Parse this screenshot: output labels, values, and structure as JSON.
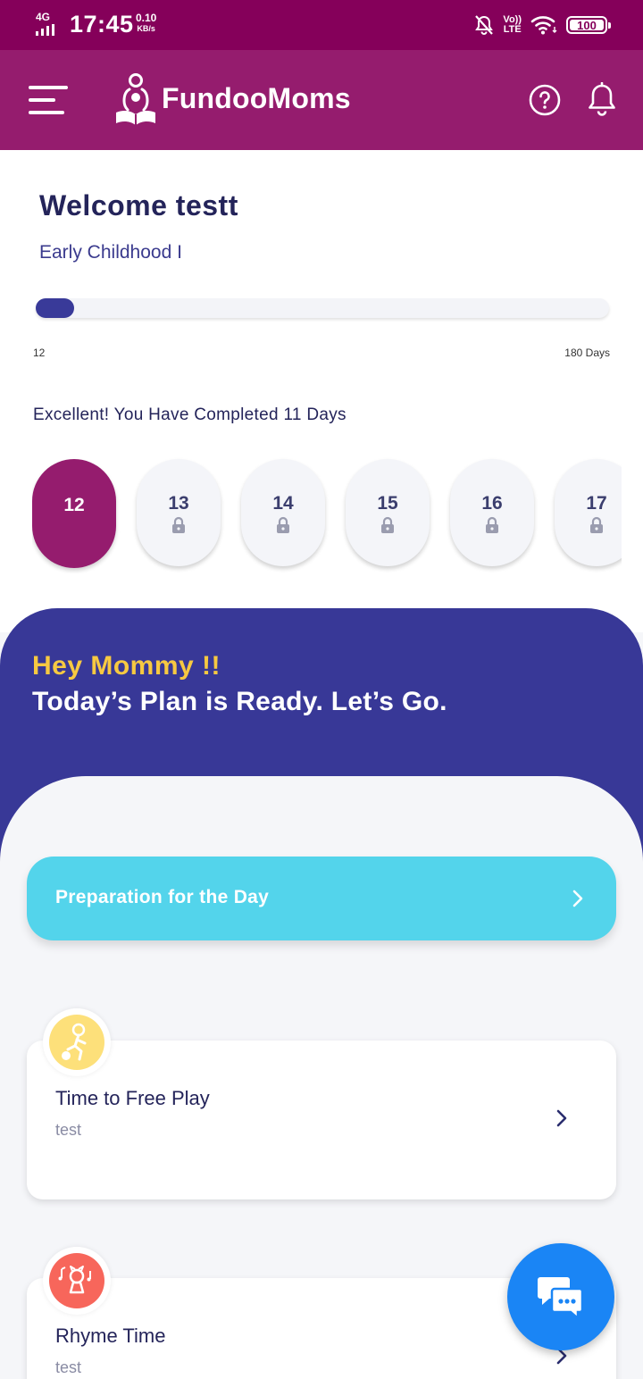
{
  "status_bar": {
    "network": "4G",
    "time": "17:45",
    "speed_value": "0.10",
    "speed_unit": "KB/s",
    "volte": "Vo))",
    "lte": "LTE",
    "battery": "100"
  },
  "header": {
    "brand": "FundooMoms",
    "icons": [
      "menu-icon",
      "mother-reading-logo",
      "help-icon",
      "bell-icon"
    ]
  },
  "welcome": {
    "title": "Welcome testt",
    "stage": "Early Childhood I",
    "progress_current_day": 12,
    "progress_total_days": 180,
    "progress_start_label": "12",
    "progress_end_label": "180 Days",
    "completed_message": "Excellent! You Have Completed 11 Days"
  },
  "days": [
    {
      "number": "12",
      "state": "active"
    },
    {
      "number": "13",
      "state": "locked"
    },
    {
      "number": "14",
      "state": "locked"
    },
    {
      "number": "15",
      "state": "locked"
    },
    {
      "number": "16",
      "state": "locked"
    },
    {
      "number": "17",
      "state": "locked"
    }
  ],
  "plan": {
    "greeting": "Hey Mommy !!",
    "title": "Today’s Plan is Ready. Let’s Go.",
    "preparation_label": "Preparation for the Day",
    "activities": [
      {
        "title": "Time to Free Play",
        "subtitle": "test",
        "icon": "free-play-icon",
        "icon_color": "#fde07a"
      },
      {
        "title": "Rhyme Time",
        "subtitle": "test",
        "icon": "rhyme-icon",
        "icon_color": "#f7665b"
      }
    ]
  },
  "colors": {
    "status_bar": "#85005a",
    "app_bar": "#951c6e",
    "navy": "#383897",
    "accent_yellow": "#f7c941",
    "prep_cyan": "#53d4eb",
    "chat_blue": "#1a85f5"
  }
}
